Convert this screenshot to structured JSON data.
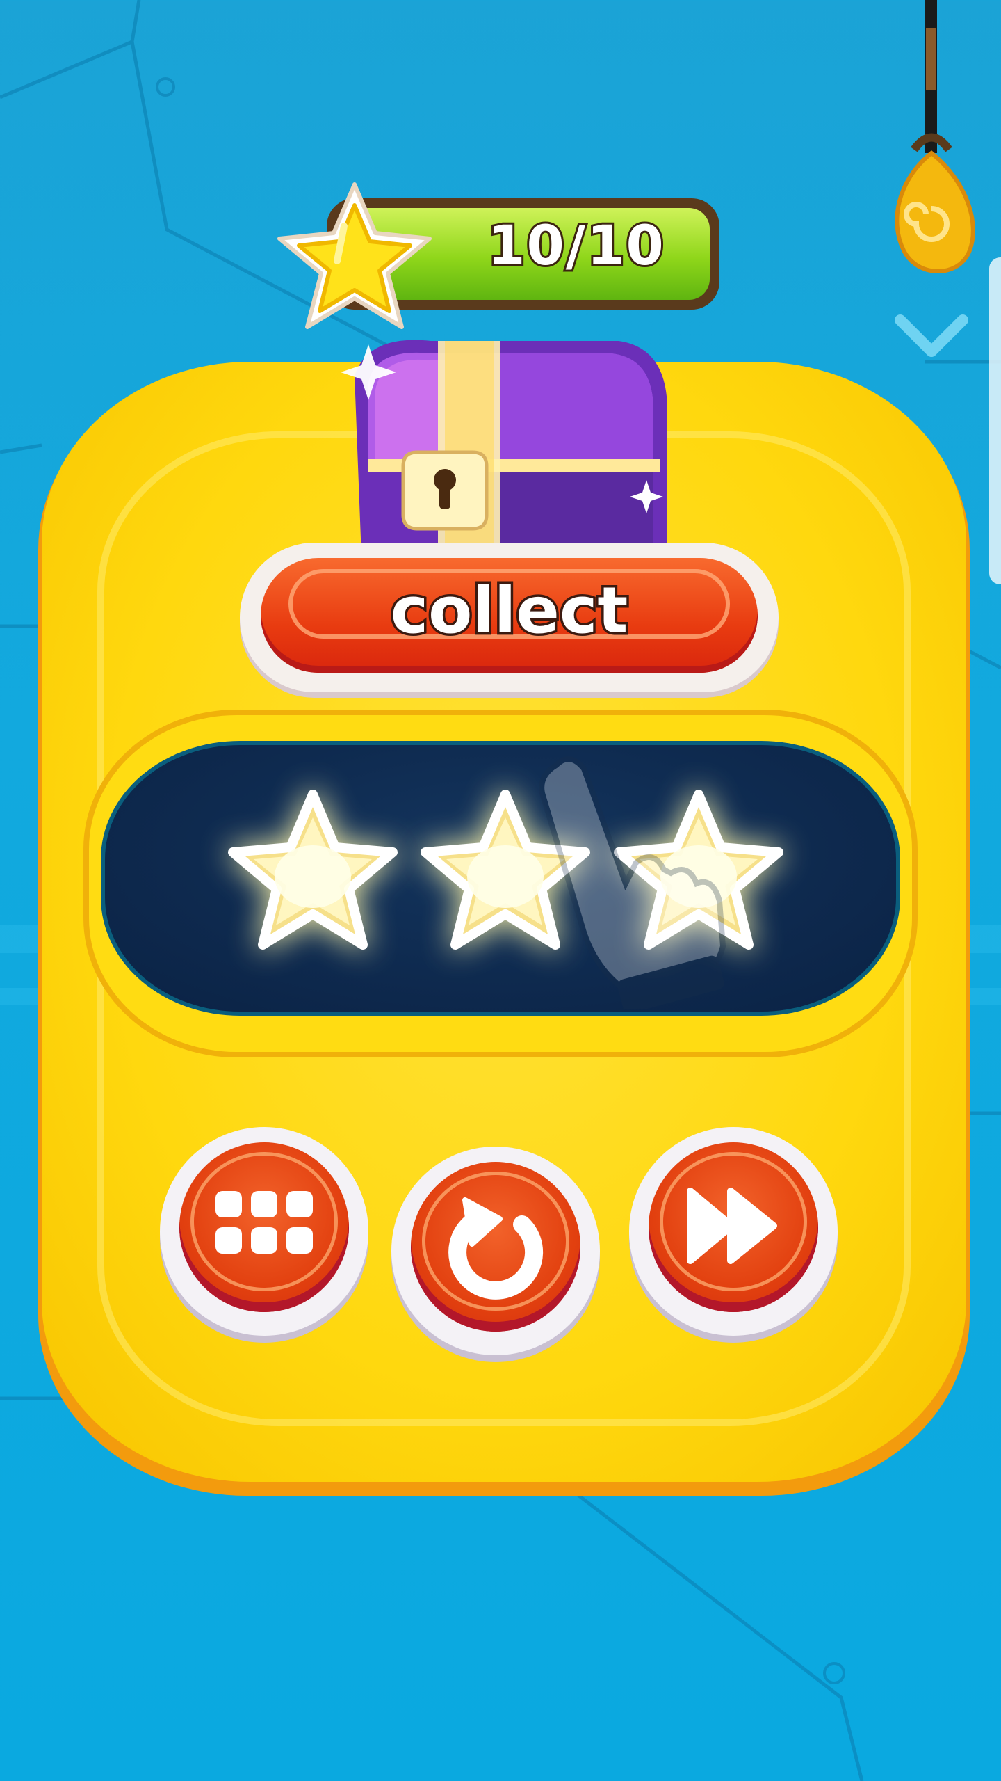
{
  "hud": {
    "star_progress": "10/10"
  },
  "reward": {
    "collect_label": "collect"
  },
  "level_result": {
    "stars_earned": 3,
    "stars_total": 3
  },
  "buttons": {
    "menu_icon": "grid-menu-icon",
    "restart_icon": "restart-icon",
    "next_icon": "fast-forward-icon"
  },
  "colors": {
    "background": "#12a9de",
    "panel": "#ffd80e",
    "button_red": "#e2400f",
    "progress_green": "#8fd61a",
    "star_window": "#0e2a4f"
  }
}
